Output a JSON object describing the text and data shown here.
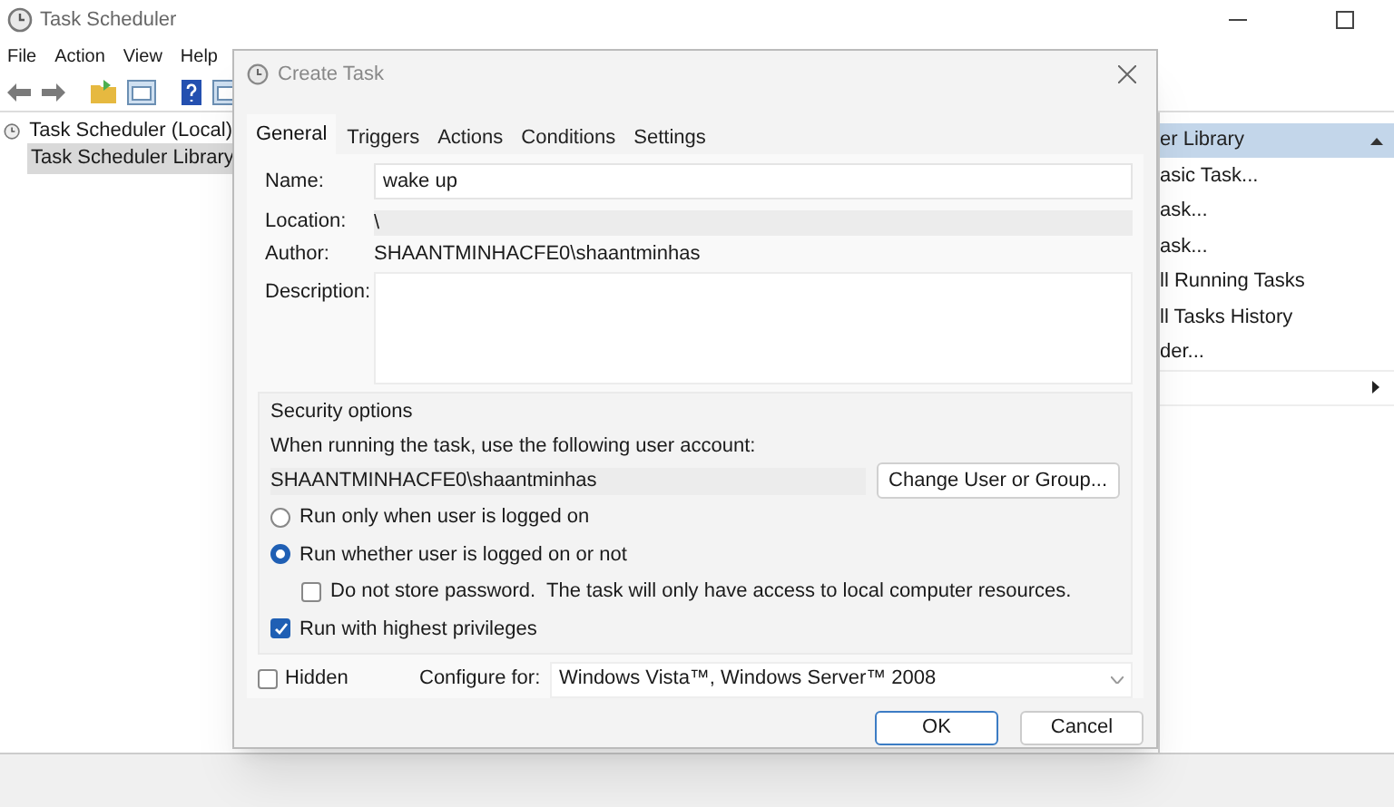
{
  "window": {
    "title": "Task Scheduler"
  },
  "menu": [
    "File",
    "Action",
    "View",
    "Help"
  ],
  "tree": [
    {
      "label": "Task Scheduler (Local)",
      "selected": false,
      "children": [
        {
          "label": "Task Scheduler Library",
          "selected": true
        }
      ]
    }
  ],
  "actions_pane": {
    "header": "er Library",
    "items": [
      {
        "kind": "text",
        "label": "asic Task..."
      },
      {
        "kind": "text",
        "label": "ask..."
      },
      {
        "kind": "text",
        "label": "ask..."
      },
      {
        "kind": "text",
        "label": "ll Running Tasks"
      },
      {
        "kind": "text",
        "label": "ll Tasks History"
      },
      {
        "kind": "text",
        "label": "der..."
      },
      {
        "kind": "submenu"
      }
    ]
  },
  "dialog": {
    "title": "Create Task",
    "tabs": [
      {
        "label": "General",
        "selected": true
      },
      {
        "label": "Triggers",
        "selected": false
      },
      {
        "label": "Actions",
        "selected": false
      },
      {
        "label": "Conditions",
        "selected": false
      },
      {
        "label": "Settings",
        "selected": false
      }
    ],
    "name": {
      "label": "Name:",
      "value": "wake up"
    },
    "location": {
      "label": "Location:",
      "value": "\\"
    },
    "author": {
      "label": "Author:",
      "value": "SHAANTMINHACFE0\\shaantminhas"
    },
    "description": {
      "label": "Description:"
    },
    "security": {
      "title": "Security options",
      "prompt": "When running the task, use the following user account:",
      "account": "SHAANTMINHACFE0\\shaantminhas",
      "change_button": "Change User or Group...",
      "options": [
        {
          "kind": "radio",
          "label": "Run only when user is logged on",
          "selected": false
        },
        {
          "kind": "radio",
          "label": "Run whether user is logged on or not",
          "selected": true
        },
        {
          "kind": "checkbox",
          "label": "Do not store password.  The task will only have access to local computer resources.",
          "checked": false,
          "indented": true
        },
        {
          "kind": "checkbox",
          "label": "Run with highest privileges",
          "checked": true,
          "indented": false
        }
      ]
    },
    "hidden": {
      "label": "Hidden",
      "checked": false
    },
    "configure": {
      "label": "Configure for:",
      "value": "Windows Vista™, Windows Server™ 2008"
    },
    "buttons": [
      {
        "label": "OK",
        "default": true
      },
      {
        "label": "Cancel",
        "default": false
      }
    ]
  }
}
